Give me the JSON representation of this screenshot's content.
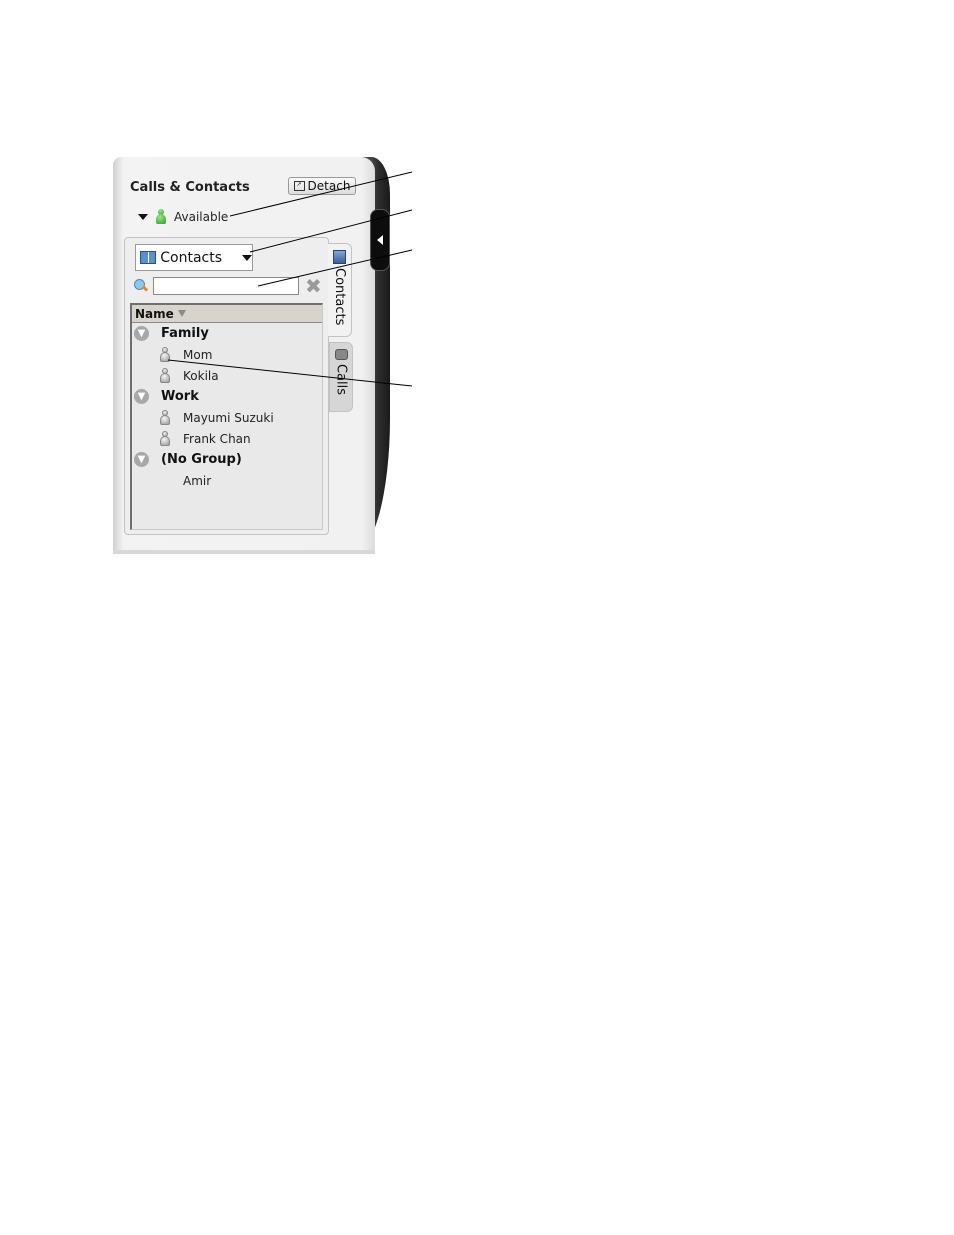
{
  "window": {
    "title": "Calls & Contacts",
    "detach_label": "Detach"
  },
  "status": {
    "label": "Available",
    "color": "#2f9a2a"
  },
  "directory": {
    "selected": "Contacts"
  },
  "search": {
    "value": "",
    "placeholder": ""
  },
  "list": {
    "column_header": "Name",
    "groups": [
      {
        "name": "Family",
        "contacts": [
          "Mom",
          "Kokila"
        ]
      },
      {
        "name": "Work",
        "contacts": [
          "Mayumi Suzuki",
          "Frank Chan"
        ]
      },
      {
        "name": "(No Group)",
        "contacts": [
          "Amir"
        ]
      }
    ]
  },
  "tabs": [
    {
      "label": "Contacts",
      "active": true
    },
    {
      "label": "Calls",
      "active": false
    }
  ]
}
